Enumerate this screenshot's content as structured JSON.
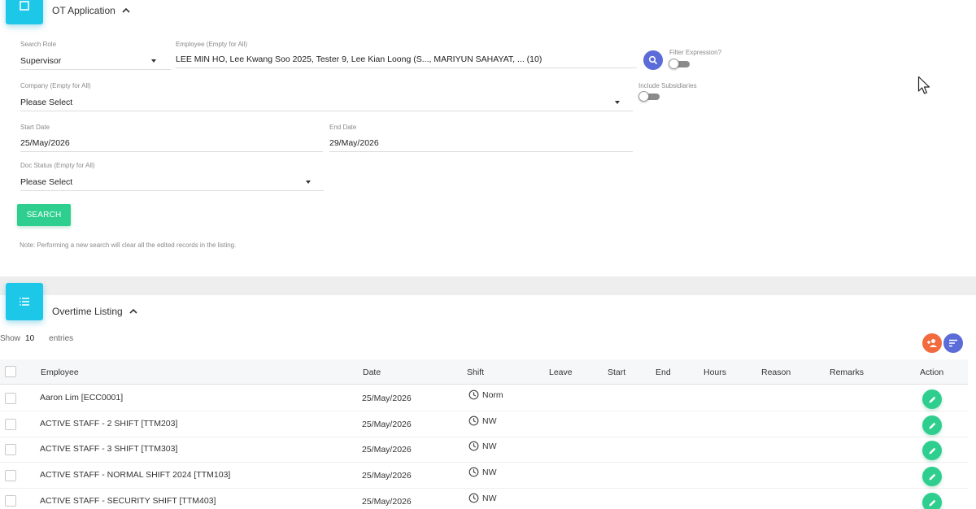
{
  "ot_section": {
    "title": "OT Application",
    "icon": "form-icon"
  },
  "form": {
    "search_role": {
      "label": "Search Role",
      "value": "Supervisor"
    },
    "employee": {
      "label": "Employee (Empty for All)",
      "value": "LEE MIN HO, Lee Kwang Soo 2025, Tester 9, Lee Kian Loong (S..., MARIYUN SAHAYAT, ... (10)"
    },
    "filter_expression": {
      "label": "Filter Expression?"
    },
    "company": {
      "label": "Company (Empty for All)",
      "value": "Please Select"
    },
    "include_subsidiaries": {
      "label": "Include Subsidiaries"
    },
    "start_date": {
      "label": "Start Date",
      "value": "25/May/2026"
    },
    "end_date": {
      "label": "End Date",
      "value": "29/May/2026"
    },
    "doc_status": {
      "label": "Doc Status (Empty for All)",
      "value": "Please Select"
    },
    "search_button": "SEARCH",
    "note": "Note: Performing a new search will clear all the edited records in the listing."
  },
  "listing_section": {
    "title": "Overtime Listing",
    "icon": "list-icon",
    "show_label": "Show",
    "show_count": "10",
    "entries_label": "entries"
  },
  "colors": {
    "accent_cyan": "#1cc7e8",
    "green": "#2ecf8e",
    "indigo": "#5b6bd8",
    "orange": "#f26a3d"
  },
  "table": {
    "columns": [
      "Employee",
      "Date",
      "Shift",
      "Leave",
      "Start",
      "End",
      "Hours",
      "Reason",
      "Remarks",
      "Action"
    ],
    "rows": [
      {
        "employee": "Aaron Lim [ECC0001]",
        "date": "25/May/2026",
        "shift": "Norm"
      },
      {
        "employee": "ACTIVE STAFF - 2 SHIFT [TTM203]",
        "date": "25/May/2026",
        "shift": "NW"
      },
      {
        "employee": "ACTIVE STAFF - 3 SHIFT [TTM303]",
        "date": "25/May/2026",
        "shift": "NW"
      },
      {
        "employee": "ACTIVE STAFF - NORMAL SHIFT 2024 [TTM103]",
        "date": "25/May/2026",
        "shift": "NW"
      },
      {
        "employee": "ACTIVE STAFF - SECURITY SHIFT [TTM403]",
        "date": "25/May/2026",
        "shift": "NW"
      }
    ]
  }
}
